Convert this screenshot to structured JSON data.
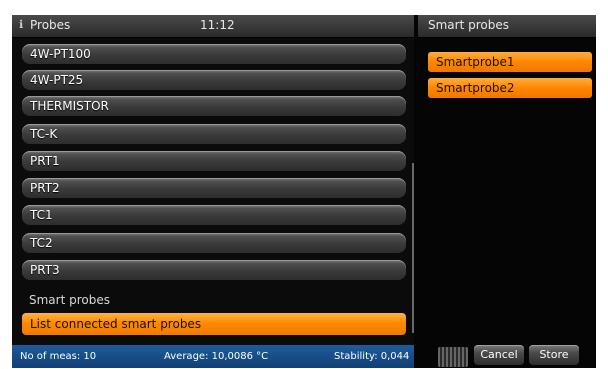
{
  "left_panel": {
    "title": "Probes",
    "time": "11:12",
    "items": [
      {
        "label": "4W-PT100"
      },
      {
        "label": "4W-PT25"
      },
      {
        "label": "THERMISTOR"
      },
      {
        "label": "TC-K"
      },
      {
        "label": "PRT1"
      },
      {
        "label": "PRT2"
      },
      {
        "label": "TC1"
      },
      {
        "label": "TC2"
      },
      {
        "label": "PRT3"
      }
    ],
    "section_label": "Smart probes",
    "action_button": "List connected smart probes"
  },
  "status_bar": {
    "meas": "No of meas: 10",
    "average": "Average: 10,0086 °C",
    "stability": "Stability: 0,044"
  },
  "right_panel": {
    "title": "Smart probes",
    "probes": [
      {
        "label": "Smartprobe1"
      },
      {
        "label": "Smartprobe2"
      }
    ],
    "cancel": "Cancel",
    "store": "Store"
  },
  "colors": {
    "accent": "#ff8a00",
    "status_bar": "#1b4f88"
  },
  "icons": {
    "header_icon": "info-icon"
  }
}
